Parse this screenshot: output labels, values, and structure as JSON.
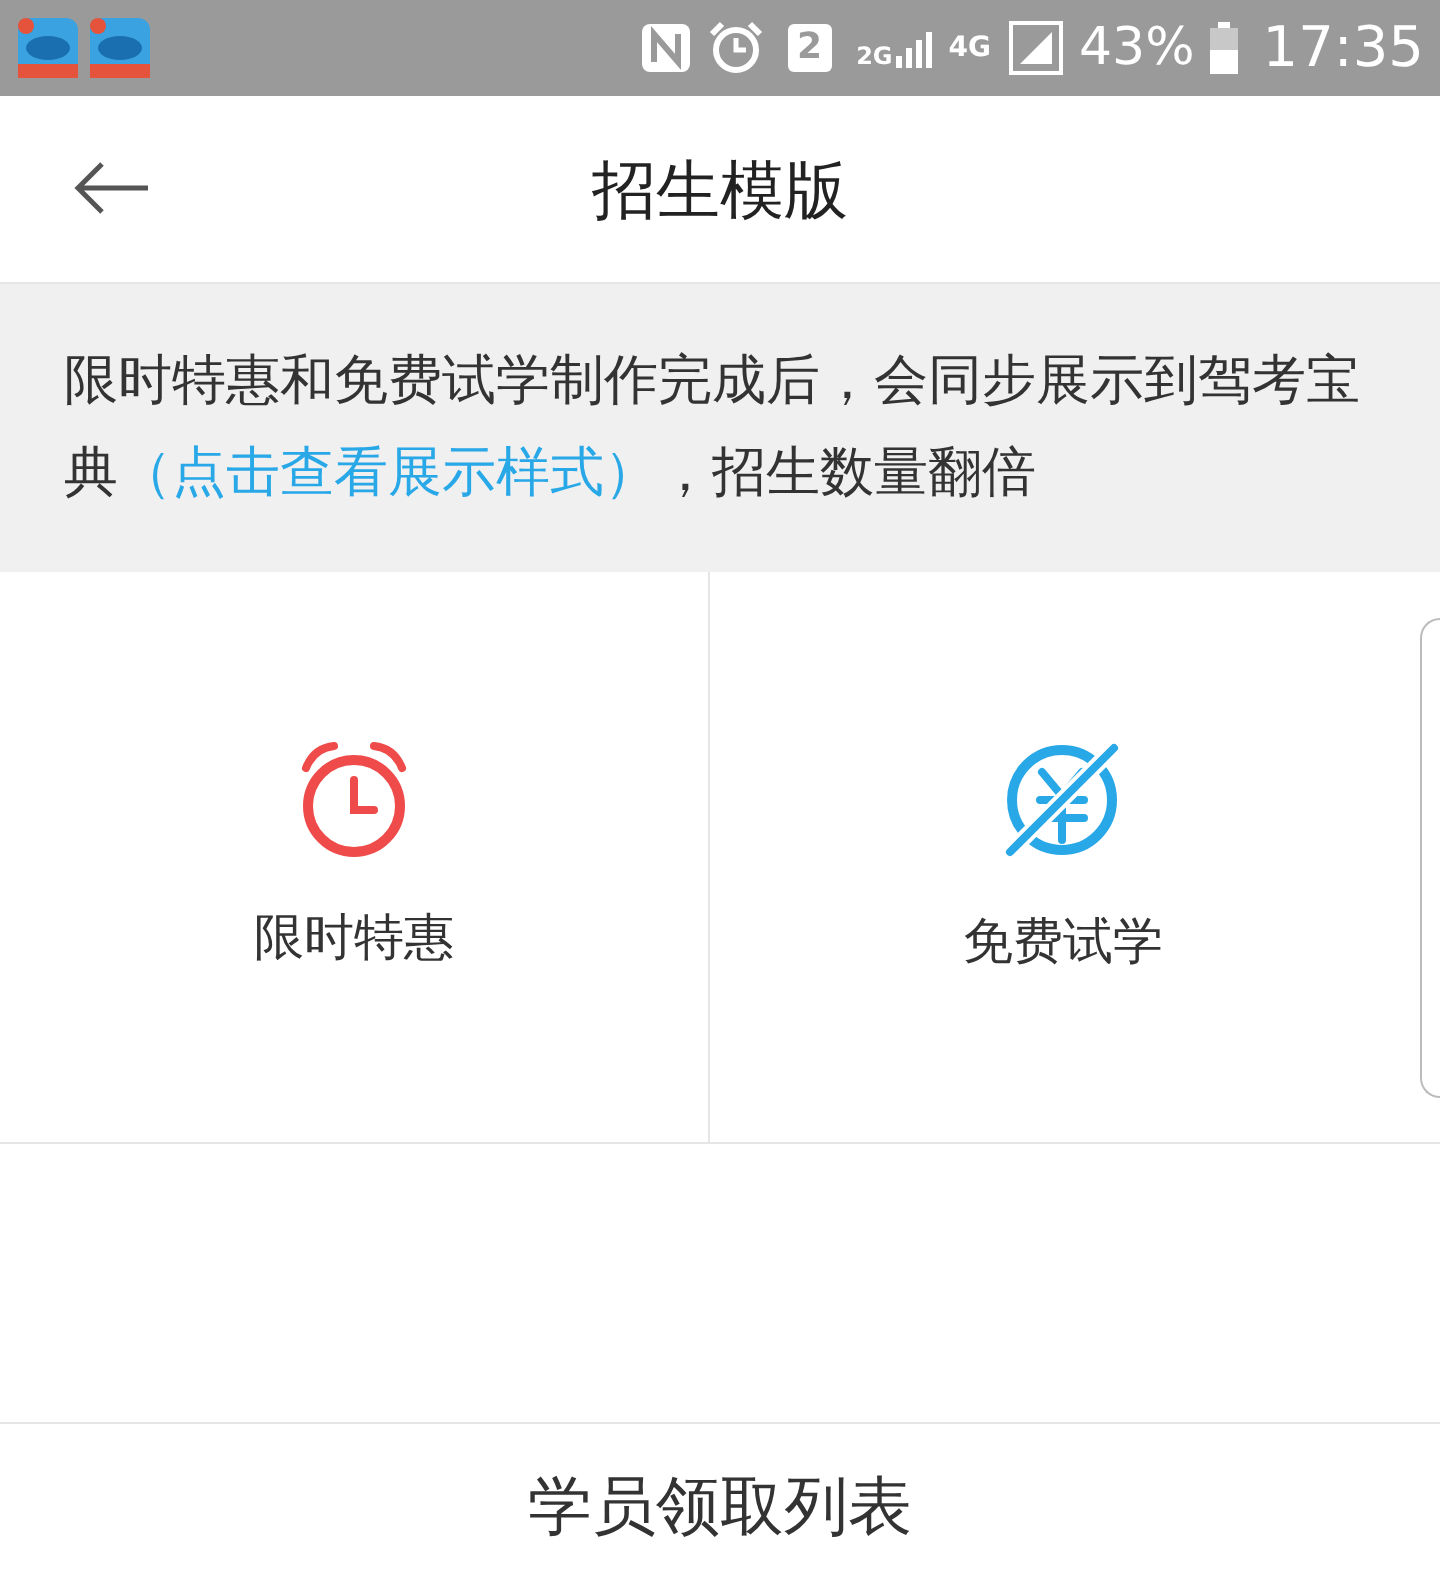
{
  "status_bar": {
    "sim_slot": "2",
    "network_2g": "2G",
    "network_4g": "4G",
    "battery": "43%",
    "time": "17:35"
  },
  "header": {
    "title": "招生模版"
  },
  "notice": {
    "text_before": "限时特惠和免费试学制作完成后，会同步展示到驾考宝典",
    "link": "（点击查看展示样式）",
    "text_after": "，招生数量翻倍"
  },
  "templates": [
    {
      "kind": "clock",
      "label": "限时特惠"
    },
    {
      "kind": "free",
      "label": "免费试学"
    }
  ],
  "footer": {
    "label": "学员领取列表"
  }
}
